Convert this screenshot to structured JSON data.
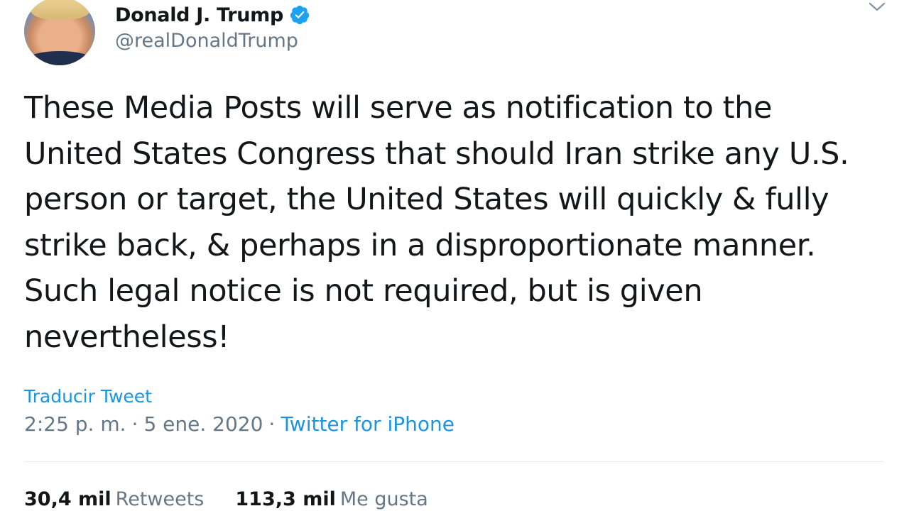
{
  "author": {
    "display_name": "Donald J. Trump",
    "handle": "@realDonaldTrump",
    "verified": true
  },
  "tweet": {
    "text": "These Media Posts will serve as notification to the\nUnited States Congress that should Iran strike any U.S.\nperson or target, the United States will quickly & fully\nstrike back, & perhaps in a disproportionate manner.\nSuch legal notice is not required, but is given\nnevertheless!",
    "translate_label": "Traducir Tweet",
    "time": "2:25 p. m.",
    "separator": "·",
    "date": "5 ene. 2020",
    "source": "Twitter for iPhone"
  },
  "stats": {
    "retweets_count": "30,4 mil",
    "retweets_label": "Retweets",
    "likes_count": "113,3 mil",
    "likes_label": "Me gusta"
  },
  "icons": {
    "verified": "verified-badge-icon",
    "more": "chevron-down-icon"
  },
  "colors": {
    "link": "#1b95e0",
    "secondary_text": "#657786",
    "verified": "#1da1f2"
  }
}
